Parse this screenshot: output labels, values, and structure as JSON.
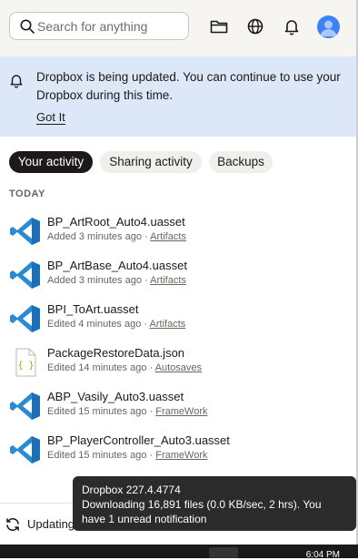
{
  "search": {
    "placeholder": "Search for anything"
  },
  "header": {
    "icons": [
      "folder-icon",
      "globe-icon",
      "bell-icon"
    ],
    "avatar_color": "#3d82f5"
  },
  "banner": {
    "message": "Dropbox is being updated. You can continue to use your Dropbox during this time.",
    "action": "Got It",
    "background": "#dce8f8"
  },
  "tabs": [
    {
      "label": "Your activity",
      "active": true
    },
    {
      "label": "Sharing activity",
      "active": false
    },
    {
      "label": "Backups",
      "active": false
    }
  ],
  "section_title": "TODAY",
  "files": [
    {
      "name": "BP_ArtRoot_Auto4.uasset",
      "action": "Added 3 minutes ago · ",
      "folder": "Artifacts",
      "icon": "vscode-icon"
    },
    {
      "name": "BP_ArtBase_Auto4.uasset",
      "action": "Added 3 minutes ago · ",
      "folder": "Artifacts",
      "icon": "vscode-icon"
    },
    {
      "name": "BPI_ToArt.uasset",
      "action": "Edited 4 minutes ago · ",
      "folder": "Artifacts",
      "icon": "vscode-icon"
    },
    {
      "name": "PackageRestoreData.json",
      "action": "Edited 14 minutes ago · ",
      "folder": "Autosaves",
      "icon": "json-file-icon"
    },
    {
      "name": "ABP_Vasily_Auto3.uasset",
      "action": "Edited 15 minutes ago · ",
      "folder": "FrameWork",
      "icon": "vscode-icon"
    },
    {
      "name": "BP_PlayerController_Auto3.uasset",
      "action": "Edited 15 minutes ago · ",
      "folder": "FrameWork",
      "icon": "vscode-icon"
    }
  ],
  "footer": {
    "status": "Updating"
  },
  "tooltip": {
    "title": "Dropbox 227.4.4774",
    "body": "Downloading 16,891 files (0.0 KB/sec, 2 hrs). You have 1 unread notification"
  },
  "taskbar": {
    "time": "6:04 PM"
  },
  "colors": {
    "accent": "#1e1919",
    "vscode_blue": "#2a8ad4",
    "header_bg": "#f7f5f2"
  }
}
